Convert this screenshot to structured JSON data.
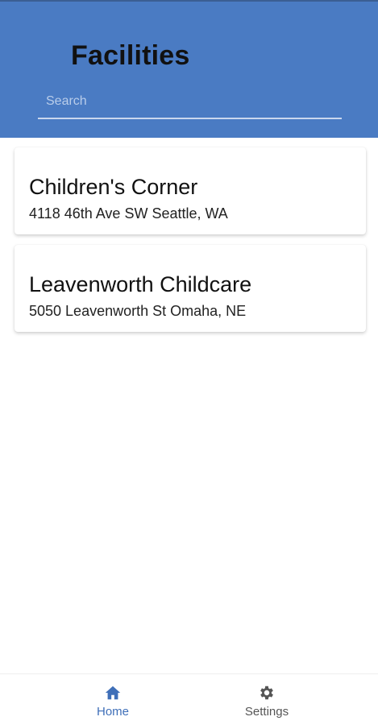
{
  "header": {
    "title": "Facilities",
    "search": {
      "placeholder": "Search",
      "value": ""
    }
  },
  "facilities": [
    {
      "name": "Children's Corner",
      "address": "4118 46th Ave SW Seattle, WA"
    },
    {
      "name": "Leavenworth Childcare",
      "address": "5050 Leavenworth St Omaha, NE"
    }
  ],
  "bottom_nav": {
    "items": [
      {
        "label": "Home",
        "icon": "home-icon",
        "active": true
      },
      {
        "label": "Settings",
        "icon": "gear-icon",
        "active": false
      }
    ]
  },
  "colors": {
    "header_bg": "#4a7bc3",
    "active_nav": "#3f6fb8",
    "inactive_nav": "#555555"
  }
}
